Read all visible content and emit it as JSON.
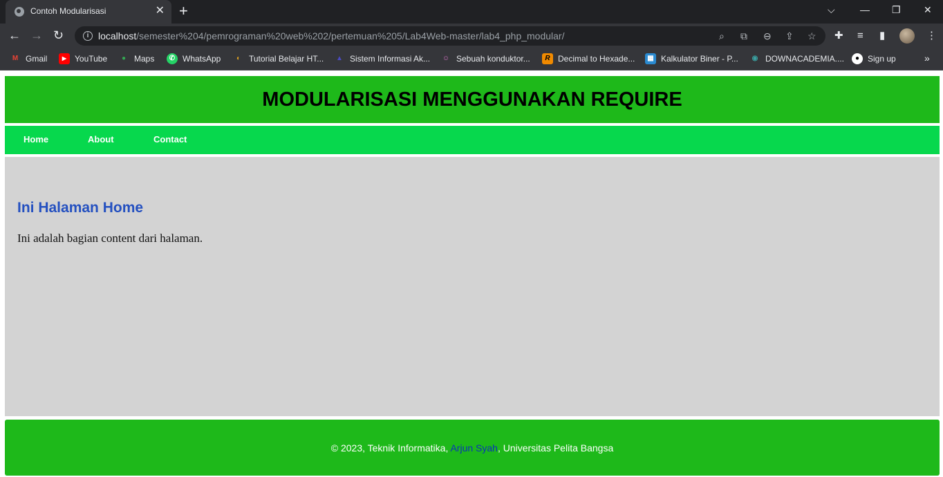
{
  "browser": {
    "tab_title": "Contoh Modularisasi",
    "tab_close": "✕",
    "new_tab": "+",
    "url_host": "localhost",
    "url_path": "/semester%204/pemrograman%20web%202/pertemuan%205/Lab4Web-master/lab4_php_modular/",
    "bookmarks": [
      {
        "label": "Gmail",
        "icon": "gmail-icon",
        "color": "#ea4335",
        "glyph": "M"
      },
      {
        "label": "YouTube",
        "icon": "youtube-icon",
        "color": "#ff0000",
        "glyph": "▶"
      },
      {
        "label": "Maps",
        "icon": "maps-icon",
        "color": "#34a853",
        "glyph": "●"
      },
      {
        "label": "WhatsApp",
        "icon": "whatsapp-icon",
        "color": "#25d366",
        "glyph": "✆"
      },
      {
        "label": "Tutorial Belajar HT...",
        "icon": "tutorial-icon",
        "color": "#e0a020",
        "glyph": "◐"
      },
      {
        "label": "Sistem Informasi Ak...",
        "icon": "sistem-icon",
        "color": "#2a2a8a",
        "glyph": "▲"
      },
      {
        "label": "Sebuah konduktor...",
        "icon": "sebuah-icon",
        "color": "#d070c0",
        "glyph": "☺"
      },
      {
        "label": "Decimal to Hexade...",
        "icon": "decimal-icon",
        "color": "#f08a00",
        "glyph": "R"
      },
      {
        "label": "Kalkulator Biner - P...",
        "icon": "kalkulator-icon",
        "color": "#2a8ad0",
        "glyph": "▦"
      },
      {
        "label": "DOWNACADEMIA....",
        "icon": "downacademia-icon",
        "color": "#3aa0a0",
        "glyph": "◉"
      },
      {
        "label": "Sign up",
        "icon": "github-icon",
        "color": "#ffffff",
        "glyph": "●"
      }
    ],
    "bookmarks_more": "»"
  },
  "page": {
    "header_title": "MODULARISASI MENGGUNAKAN REQUIRE",
    "nav": [
      "Home",
      "About",
      "Contact"
    ],
    "content_heading": "Ini Halaman Home",
    "content_text": "Ini adalah bagian content dari halaman.",
    "footer_prefix": "© 2023, Teknik Informatika, ",
    "footer_link": "Arjun Syah",
    "footer_suffix": ", Universitas Pelita Bangsa"
  },
  "colors": {
    "header_bg": "#1eb91a",
    "nav_bg": "#07d84d",
    "content_bg": "#d3d3d3",
    "heading": "#2450c0",
    "footer_link": "#0a32b8"
  }
}
